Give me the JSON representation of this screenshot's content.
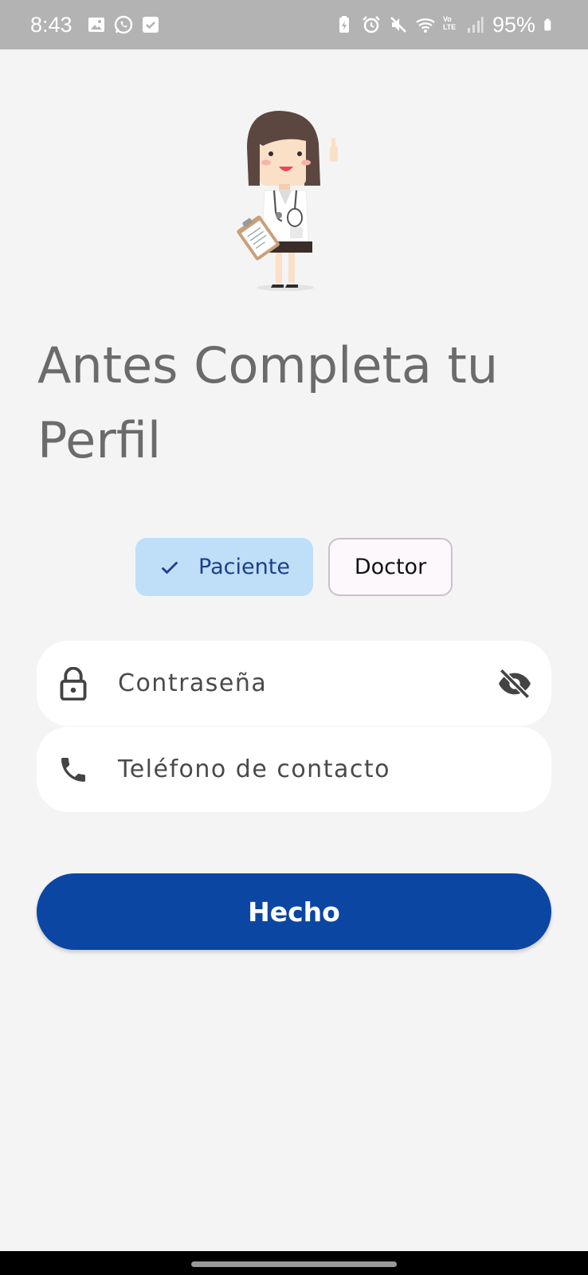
{
  "status_bar": {
    "time": "8:43",
    "battery_percent": "95%",
    "left_icons": [
      "gallery-icon",
      "whatsapp-icon",
      "checkbox-icon"
    ],
    "right_icons": [
      "battery-saver-icon",
      "alarm-icon",
      "mute-icon",
      "wifi-icon",
      "volte-icon",
      "signal-icon",
      "battery-icon"
    ],
    "volte_label": "Vo LTE"
  },
  "headline": "Antes Completa tu Perfil",
  "role_selector": {
    "options": [
      {
        "label": "Paciente",
        "selected": true
      },
      {
        "label": "Doctor",
        "selected": false
      }
    ]
  },
  "form": {
    "password_placeholder": "Contraseña",
    "phone_placeholder": "Teléfono de contacto"
  },
  "submit_label": "Hecho",
  "colors": {
    "background": "#f4f4f4",
    "primary": "#0c46a3",
    "chip_selected": "#bfdff8",
    "headline": "#6b6b6b"
  }
}
